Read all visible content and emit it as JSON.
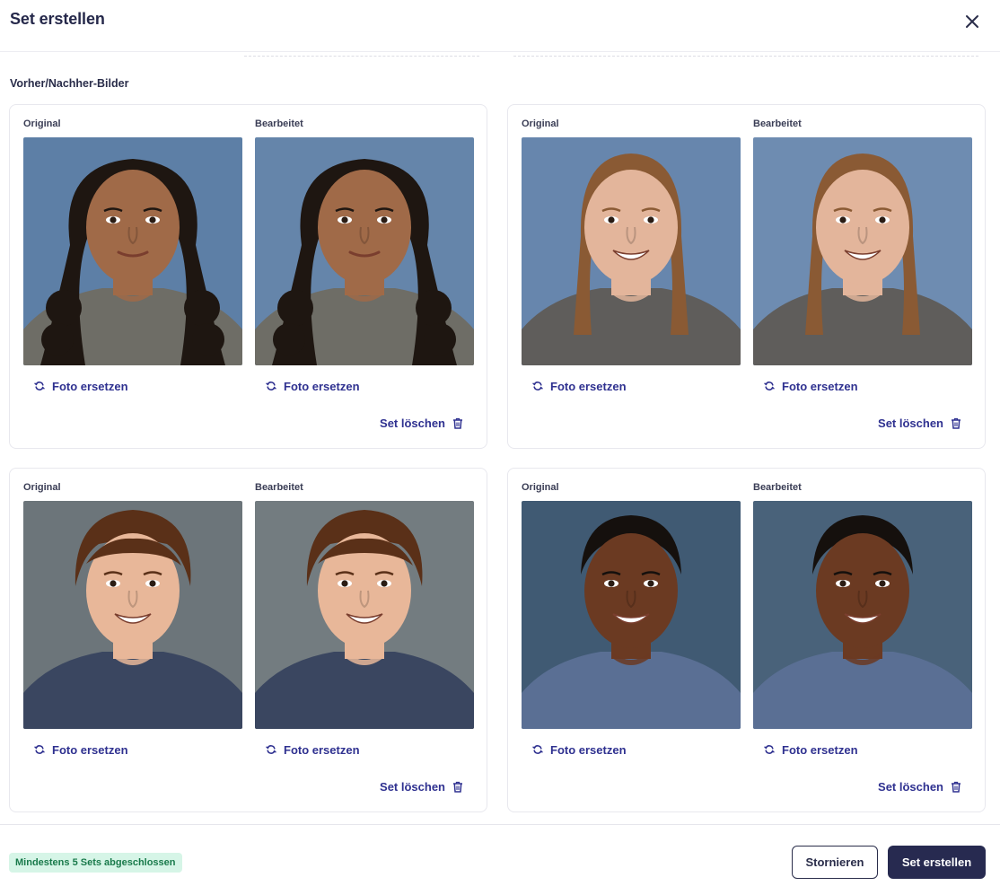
{
  "dialog": {
    "title": "Set erstellen",
    "close_icon": "close-icon"
  },
  "section": {
    "label": "Vorher/Nachher-Bilder"
  },
  "sets": [
    {
      "original_label": "Original",
      "edited_label": "Bearbeitet",
      "replace_original": "Foto ersetzen",
      "replace_edited": "Foto ersetzen",
      "delete_label": "Set löschen",
      "photo": {
        "bg": "#5d7fa6",
        "skin": "#a06a48",
        "hair": "#1e1611",
        "shirt": "#6e6d66",
        "hair_style": "long-curly"
      }
    },
    {
      "original_label": "Original",
      "edited_label": "Bearbeitet",
      "replace_original": "Foto ersetzen",
      "replace_edited": "Foto ersetzen",
      "delete_label": "Set löschen",
      "photo": {
        "bg": "#6786ad",
        "skin": "#e3b59b",
        "hair": "#8a5a34",
        "shirt": "#5f5d5b",
        "hair_style": "long-straight"
      }
    },
    {
      "original_label": "Original",
      "edited_label": "Bearbeitet",
      "replace_original": "Foto ersetzen",
      "replace_edited": "Foto ersetzen",
      "delete_label": "Set löschen",
      "photo": {
        "bg": "#6c757a",
        "skin": "#e8b799",
        "hair": "#5a3018",
        "shirt": "#3a4660",
        "hair_style": "short"
      }
    },
    {
      "original_label": "Original",
      "edited_label": "Bearbeitet",
      "replace_original": "Foto ersetzen",
      "replace_edited": "Foto ersetzen",
      "delete_label": "Set löschen",
      "photo": {
        "bg": "#405a73",
        "skin": "#6b3a22",
        "hair": "#15100d",
        "shirt": "#5a6f94",
        "hair_style": "buzz"
      }
    }
  ],
  "footer": {
    "status": "Mindestens 5 Sets abgeschlossen",
    "cancel_label": "Stornieren",
    "submit_label": "Set erstellen"
  },
  "colors": {
    "accent": "#2f3190",
    "primary_button": "#272a50",
    "badge_bg": "#d6f5e7",
    "badge_text": "#197a4b"
  }
}
